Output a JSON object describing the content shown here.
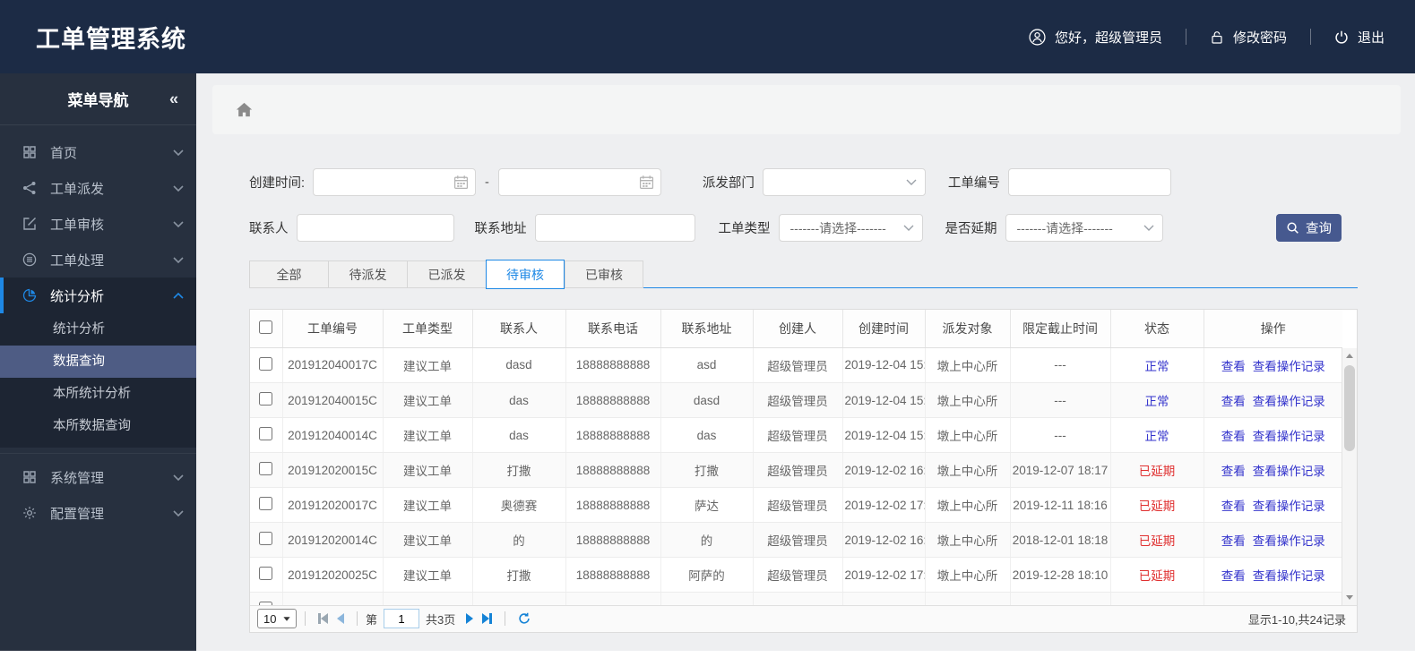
{
  "app": {
    "title": "工单管理系统"
  },
  "header": {
    "greeting": "您好，超级管理员",
    "change_password": "修改密码",
    "logout": "退出"
  },
  "sidebar": {
    "title": "菜单导航",
    "collapse": "«",
    "items": [
      {
        "label": "首页",
        "icon": "grid-icon"
      },
      {
        "label": "工单派发",
        "icon": "share-icon"
      },
      {
        "label": "工单审核",
        "icon": "edit-icon"
      },
      {
        "label": "工单处理",
        "icon": "process-icon"
      },
      {
        "label": "统计分析",
        "icon": "pie-chart-icon"
      },
      {
        "label": "系统管理",
        "icon": "grid-icon"
      },
      {
        "label": "配置管理",
        "icon": "gear-icon"
      }
    ],
    "submenu": [
      {
        "label": "统计分析"
      },
      {
        "label": "数据查询",
        "selected": true
      },
      {
        "label": "本所统计分析"
      },
      {
        "label": "本所数据查询"
      }
    ]
  },
  "filters": {
    "create_time": "创建时间:",
    "date_separator": "-",
    "dispatch_dept": "派发部门",
    "order_no": "工单编号",
    "contact": "联系人",
    "address": "联系地址",
    "order_type": "工单类型",
    "is_delayed": "是否延期",
    "select_placeholder": "-------请选择-------",
    "search": "查询"
  },
  "tabs": [
    {
      "label": "全部"
    },
    {
      "label": "待派发"
    },
    {
      "label": "已派发"
    },
    {
      "label": "待审核",
      "active": true
    },
    {
      "label": "已审核"
    }
  ],
  "table": {
    "columns": [
      "工单编号",
      "工单类型",
      "联系人",
      "联系电话",
      "联系地址",
      "创建人",
      "创建时间",
      "派发对象",
      "限定截止时间",
      "状态",
      "操作"
    ],
    "view_label": "查看",
    "view_log_label": "查看操作记录",
    "rows": [
      {
        "order_no": "201912040017C",
        "type": "建议工单",
        "contact": "dasd",
        "phone": "18888888888",
        "address": "asd",
        "creator": "超级管理员",
        "created": "2019-12-04 15:",
        "target": "墩上中心所",
        "deadline": "---",
        "status": "正常",
        "status_type": "normal"
      },
      {
        "order_no": "201912040015C",
        "type": "建议工单",
        "contact": "das",
        "phone": "18888888888",
        "address": "dasd",
        "creator": "超级管理员",
        "created": "2019-12-04 15:",
        "target": "墩上中心所",
        "deadline": "---",
        "status": "正常",
        "status_type": "normal"
      },
      {
        "order_no": "201912040014C",
        "type": "建议工单",
        "contact": "das",
        "phone": "18888888888",
        "address": "das",
        "creator": "超级管理员",
        "created": "2019-12-04 15:",
        "target": "墩上中心所",
        "deadline": "---",
        "status": "正常",
        "status_type": "normal"
      },
      {
        "order_no": "201912020015C",
        "type": "建议工单",
        "contact": "打撒",
        "phone": "18888888888",
        "address": "打撒",
        "creator": "超级管理员",
        "created": "2019-12-02 16:",
        "target": "墩上中心所",
        "deadline": "2019-12-07 18:17",
        "status": "已延期",
        "status_type": "delayed"
      },
      {
        "order_no": "201912020017C",
        "type": "建议工单",
        "contact": "奥德赛",
        "phone": "18888888888",
        "address": "萨达",
        "creator": "超级管理员",
        "created": "2019-12-02 17:",
        "target": "墩上中心所",
        "deadline": "2019-12-11 18:16",
        "status": "已延期",
        "status_type": "delayed"
      },
      {
        "order_no": "201912020014C",
        "type": "建议工单",
        "contact": "的",
        "phone": "18888888888",
        "address": "的",
        "creator": "超级管理员",
        "created": "2019-12-02 16:",
        "target": "墩上中心所",
        "deadline": "2018-12-01 18:18",
        "status": "已延期",
        "status_type": "delayed"
      },
      {
        "order_no": "201912020025C",
        "type": "建议工单",
        "contact": "打撒",
        "phone": "18888888888",
        "address": "阿萨的",
        "creator": "超级管理员",
        "created": "2019-12-02 17:",
        "target": "墩上中心所",
        "deadline": "2019-12-28 18:10",
        "status": "已延期",
        "status_type": "delayed"
      }
    ]
  },
  "pagination": {
    "page_size": "10",
    "page_prefix": "第",
    "current_page": "1",
    "total_pages": "共3页",
    "summary": "显示1-10,共24记录"
  },
  "colors": {
    "header_bg": "#1c2b45",
    "sidebar_bg": "#27303f",
    "accent_blue": "#1e88e5",
    "search_button": "#46598f",
    "link_blue": "#3333cc",
    "status_red": "#e03030",
    "selected_menu": "#4e5c84"
  }
}
